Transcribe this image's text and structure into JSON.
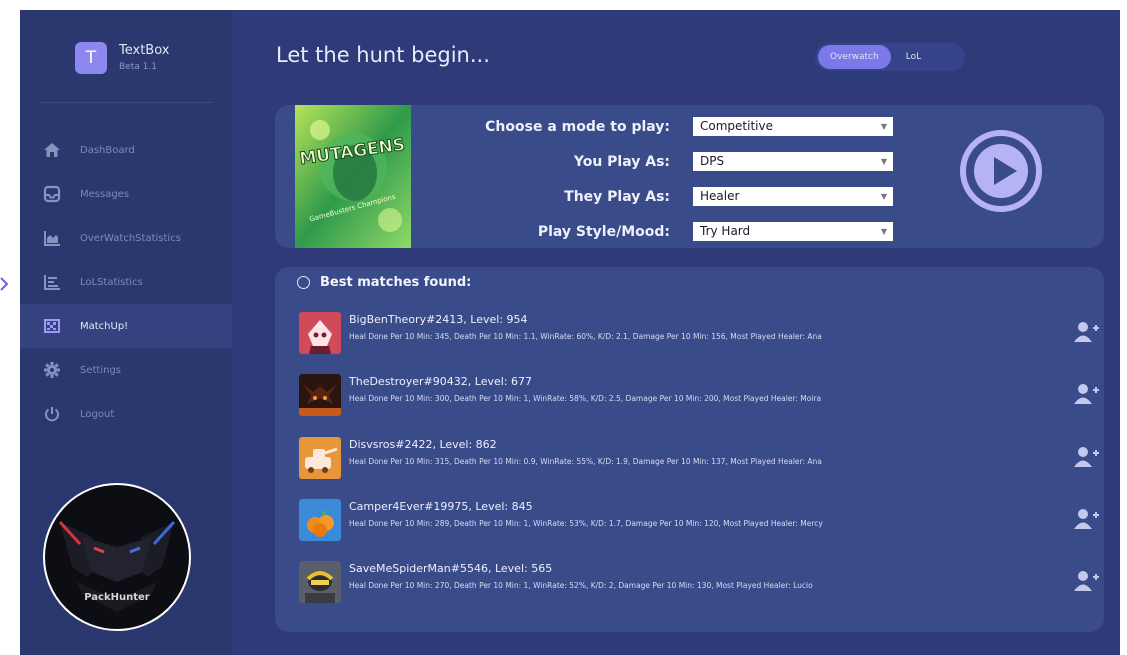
{
  "app": {
    "name": "TextBox",
    "version": "Beta 1.1",
    "logo_letter": "T",
    "accent": "#7b78e8",
    "background": "#2e3b78"
  },
  "sidebar": {
    "items": [
      {
        "label": "DashBoard",
        "icon": "home-icon"
      },
      {
        "label": "Messages",
        "icon": "message-icon"
      },
      {
        "label": "OverWatchStatistics",
        "icon": "area-chart-icon"
      },
      {
        "label": "LoLStatistics",
        "icon": "list-chart-icon"
      },
      {
        "label": "MatchUp!",
        "icon": "flag-icon",
        "active": true
      },
      {
        "label": "Settings",
        "icon": "gear-icon"
      },
      {
        "label": "Logout",
        "icon": "power-icon"
      }
    ],
    "team_logo_text": "PackHunter"
  },
  "header": {
    "title": "Let the hunt begin...",
    "games": [
      "Overwatch",
      "LoL"
    ],
    "selected_game": "Overwatch"
  },
  "mode_form": {
    "cover_title": "MUTAGENS",
    "cover_subtitle": "GameBusters Champions",
    "labels": {
      "mode": "Choose a mode to play:",
      "you_play": "You Play As:",
      "they_play": "They Play As:",
      "style": "Play Style/Mood:"
    },
    "values": {
      "mode": "Competitive",
      "you_play": "DPS",
      "they_play": "Healer",
      "style": "Try Hard"
    }
  },
  "matches": {
    "title": "Best matches found:",
    "rows": [
      {
        "name": "BigBenTheory#2413, Level: 954",
        "stats": "Heal Done Per 10 Min: 345,  Death Per 10 Min: 1.1,  WinRate: 60%,  K/D: 2.1,  Damage Per 10 Min: 156,  Most Played Healer: Ana"
      },
      {
        "name": "TheDestroyer#90432, Level: 677",
        "stats": "Heal Done Per 10 Min: 300,  Death Per 10 Min: 1,  WinRate: 58%,  K/D: 2.5,  Damage Per 10 Min: 200,  Most Played Healer: Moira"
      },
      {
        "name": "Disvsros#2422, Level: 862",
        "stats": "Heal Done Per 10 Min: 315,  Death Per 10 Min: 0.9,  WinRate: 55%,  K/D: 1.9,  Damage Per 10 Min: 137,  Most Played Healer: Ana"
      },
      {
        "name": "Camper4Ever#19975, Level: 845",
        "stats": "Heal Done Per 10 Min: 289,  Death Per 10 Min: 1,  WinRate: 53%,  K/D: 1.7,  Damage Per 10 Min: 120,  Most Played Healer: Mercy"
      },
      {
        "name": "SaveMeSpiderMan#5546, Level: 565",
        "stats": "Heal Done Per 10 Min: 270,  Death Per 10 Min: 1,  WinRate: 52%,  K/D: 2,  Damage Per 10 Min: 130,  Most Played Healer: Lucio"
      }
    ]
  }
}
